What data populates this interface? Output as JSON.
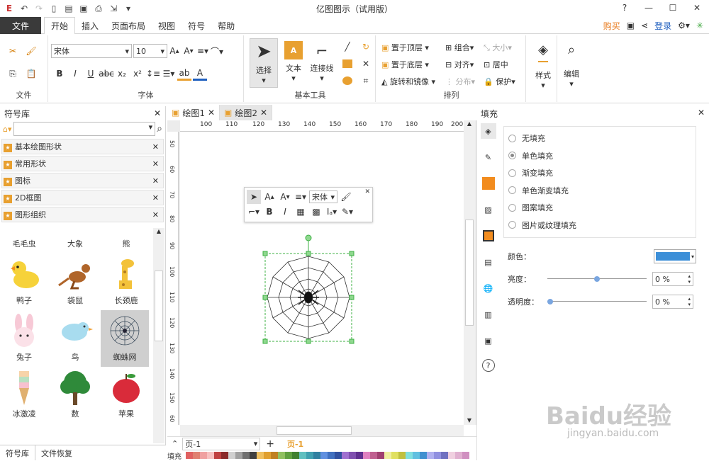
{
  "app": {
    "title": "亿图图示（试用版）"
  },
  "menu": {
    "file": "文件",
    "tabs": [
      "开始",
      "插入",
      "页面布局",
      "视图",
      "符号",
      "帮助"
    ],
    "buy": "购买",
    "login": "登录"
  },
  "ribbon": {
    "font_name": "宋体",
    "font_size": "10",
    "groups": {
      "file": "文件",
      "font": "字体",
      "basic_tools": "基本工具",
      "arrange": "排列"
    },
    "select": "选择",
    "text": "文本",
    "connector": "连接线",
    "bring_front": "置于顶层",
    "send_back": "置于底层",
    "rotate_flip": "旋转和镜像",
    "group": "组合",
    "align": "对齐",
    "distribute": "分布",
    "size": "大小",
    "center": "居中",
    "protect": "保护",
    "style": "样式",
    "edit": "编辑"
  },
  "library": {
    "title": "符号库",
    "categories": [
      "基本绘图形状",
      "常用形状",
      "图标",
      "2D框图",
      "图形组织"
    ],
    "symbols": [
      "毛毛虫",
      "大象",
      "熊",
      "鸭子",
      "袋鼠",
      "长颈鹿",
      "兔子",
      "鸟",
      "蜘蛛网",
      "冰激凌",
      "数",
      "苹果"
    ],
    "bottom_tabs": [
      "符号库",
      "文件恢复"
    ]
  },
  "docs": {
    "tabs": [
      "绘图1",
      "绘图2"
    ]
  },
  "ruler": {
    "h": [
      "100",
      "110",
      "120",
      "130",
      "140",
      "150",
      "160",
      "170",
      "180",
      "190",
      "200"
    ],
    "v": [
      "50",
      "60",
      "70",
      "80",
      "90",
      "100",
      "110",
      "120",
      "130",
      "140",
      "150",
      "160",
      "60"
    ]
  },
  "minitoolbar": {
    "font": "宋体"
  },
  "status": {
    "page_select": "页-1",
    "page_tab": "页-1",
    "fill_label": "填充"
  },
  "fill": {
    "title": "填充",
    "options": [
      "无填充",
      "单色填充",
      "渐变填充",
      "单色渐变填充",
      "图案填充",
      "图片或纹理填充"
    ],
    "selected_index": 1,
    "color_label": "颜色：",
    "brightness_label": "亮度：",
    "brightness": "0 %",
    "transparency_label": "透明度：",
    "transparency": "0 %",
    "color": "#3c8fd8",
    "brightness_level": 0.5,
    "transparency_level": 0
  },
  "colors": {
    "accent": "#e8a030",
    "selection": "#3cb043",
    "handle": "#3c8fd8"
  },
  "watermark": {
    "text1": "Baidu经验",
    "text2": "jingyan.baidu.com"
  }
}
